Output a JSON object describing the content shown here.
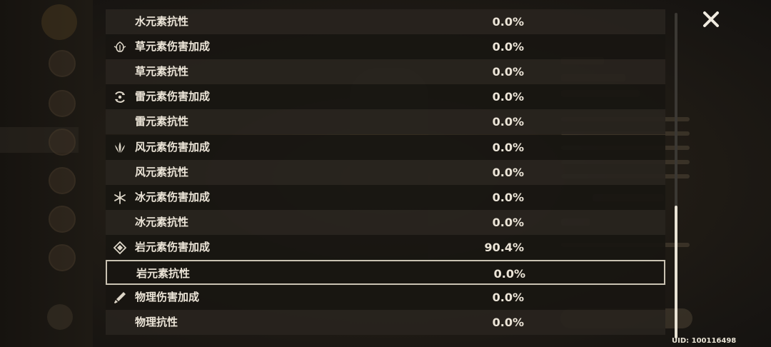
{
  "rows": [
    {
      "label": "水元素抗性",
      "value": "0.0%",
      "icon": "",
      "shade": "dark"
    },
    {
      "label": "草元素伤害加成",
      "value": "0.0%",
      "icon": "dendro-icon",
      "shade": "light"
    },
    {
      "label": "草元素抗性",
      "value": "0.0%",
      "icon": "",
      "shade": "dark"
    },
    {
      "label": "雷元素伤害加成",
      "value": "0.0%",
      "icon": "electro-icon",
      "shade": "light"
    },
    {
      "label": "雷元素抗性",
      "value": "0.0%",
      "icon": "",
      "shade": "dark"
    },
    {
      "label": "风元素伤害加成",
      "value": "0.0%",
      "icon": "anemo-icon",
      "shade": "light"
    },
    {
      "label": "风元素抗性",
      "value": "0.0%",
      "icon": "",
      "shade": "dark"
    },
    {
      "label": "冰元素伤害加成",
      "value": "0.0%",
      "icon": "cryo-icon",
      "shade": "light"
    },
    {
      "label": "冰元素抗性",
      "value": "0.0%",
      "icon": "",
      "shade": "dark"
    },
    {
      "label": "岩元素伤害加成",
      "value": "90.4%",
      "icon": "geo-icon",
      "shade": "light"
    },
    {
      "label": "岩元素抗性",
      "value": "0.0%",
      "icon": "",
      "shade": "selected"
    },
    {
      "label": "物理伤害加成",
      "value": "0.0%",
      "icon": "physical-icon",
      "shade": "light"
    },
    {
      "label": "物理抗性",
      "value": "0.0%",
      "icon": "",
      "shade": "dark"
    }
  ],
  "uid": "UID: 100116498",
  "close_icon": "close-icon",
  "colors": {
    "text": "#ece5d8",
    "row_dark": "#28241e",
    "row_light": "#181511",
    "selection": "#c9c2b2"
  }
}
